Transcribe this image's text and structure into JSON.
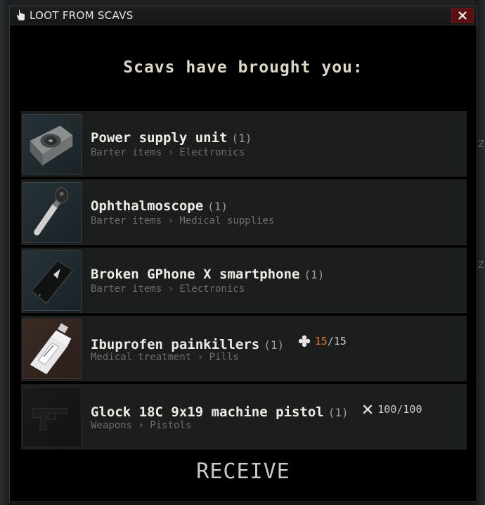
{
  "window": {
    "title": "LOOT FROM SCAVS",
    "close_symbol": "✕",
    "heading": "Scavs have brought you:",
    "receive_label": "RECEIVE"
  },
  "items": [
    {
      "name": "Power supply unit",
      "count": "(1)",
      "category": "Barter items › Electronics",
      "icon": "power-supply-icon"
    },
    {
      "name": "Ophthalmoscope",
      "count": "(1)",
      "category": "Barter items › Medical supplies",
      "icon": "ophthalmoscope-icon"
    },
    {
      "name": "Broken GPhone X smartphone",
      "count": "(1)",
      "category": "Barter items › Electronics",
      "icon": "smartphone-icon"
    },
    {
      "name": "Ibuprofen painkillers",
      "count": "(1)",
      "category": "Medical treatment › Pills",
      "icon": "pill-bottle-icon",
      "stat": {
        "icon": "medical-cross-icon",
        "current": "15",
        "separator": "/",
        "max": "15"
      }
    },
    {
      "name": "Glock 18C 9x19 machine pistol",
      "count": "(1)",
      "category": "Weapons › Pistols",
      "icon": "pistol-icon",
      "stat": {
        "icon": "durability-wrench-icon",
        "current": "100",
        "separator": "/",
        "max": "100"
      }
    }
  ],
  "background": {
    "edge_letter": "Z"
  },
  "colors": {
    "accent_orange": "#e07b26",
    "close_red": "#5a1010",
    "row_bg": "#1c1e1e"
  }
}
